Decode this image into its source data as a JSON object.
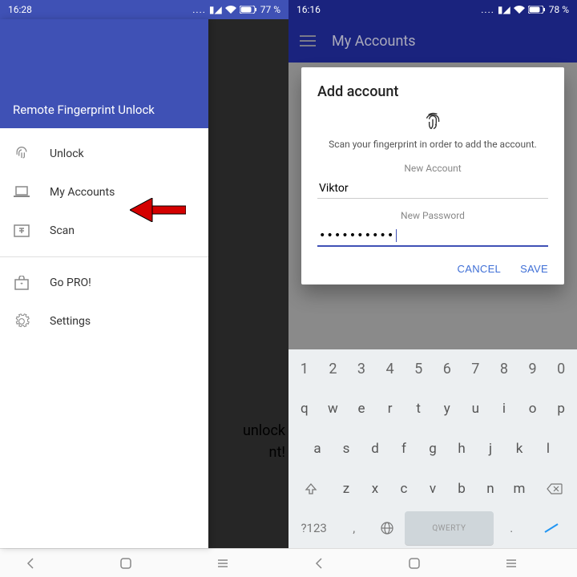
{
  "left": {
    "status_time": "16:28",
    "status_battery": "77 %",
    "app_title": "Remote Fingerprint Unlock",
    "menu": {
      "unlock": "Unlock",
      "my_accounts": "My Accounts",
      "scan": "Scan",
      "go_pro": "Go PRO!",
      "settings": "Settings"
    },
    "overlay_line1": "unlock",
    "overlay_line2": "nt!"
  },
  "right": {
    "status_time": "16:16",
    "status_battery": "78 %",
    "toolbar_title": "My Accounts",
    "dialog": {
      "title": "Add account",
      "subtitle": "Scan your fingerprint in order to add the account.",
      "account_label": "New Account",
      "account_value": "Viktor",
      "password_label": "New Password",
      "password_value": "••••••••••",
      "cancel": "CANCEL",
      "save": "SAVE"
    },
    "keyboard": {
      "row1": [
        "1",
        "2",
        "3",
        "4",
        "5",
        "6",
        "7",
        "8",
        "9",
        "0"
      ],
      "row2": [
        "q",
        "w",
        "e",
        "r",
        "t",
        "y",
        "u",
        "i",
        "o",
        "p"
      ],
      "row3": [
        "a",
        "s",
        "d",
        "f",
        "g",
        "h",
        "j",
        "k",
        "l"
      ],
      "row4": [
        "z",
        "x",
        "c",
        "v",
        "b",
        "n",
        "m"
      ],
      "symbol": "?123",
      "comma": ",",
      "space": "QWERTY",
      "period": "."
    }
  }
}
